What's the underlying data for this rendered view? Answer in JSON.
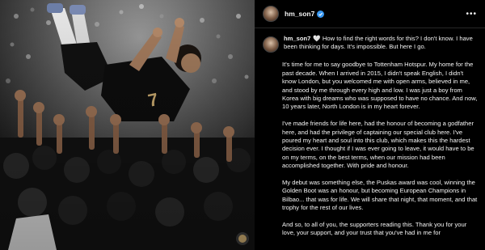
{
  "post": {
    "username": "hm_son7",
    "verified": true,
    "more_icon": "more-dots-icon",
    "avatar_icon": "profile-avatar"
  },
  "caption": {
    "username": "hm_son7",
    "first_line": "🤍 How to find the right words for this? I don't know. I have been thinking for days. It's impossible. But here I go.",
    "paragraphs": [
      "It's time for me to say goodbye to Tottenham Hotspur. My home for the past decade. When I arrived in 2015, I didn't speak English, I didn't know London, but you welcomed me with open arms, believed in me, and stood by me through every high and low. I was just a boy from Korea with big dreams who was supposed to have no chance. And now, 10 years later, North London is in my heart forever.",
      "I've made friends for life here, had the honour of becoming a godfather here, and had the privilege of captaining our special club here. I've poured my heart and soul into this club, which makes this the hardest decision ever. I thought if I was ever going to leave, it would have to be on my terms, on the best terms, when our mission had been accomplished together. With pride and honour.",
      "My debut was something else, the Puskas award was cool, winning the Golden Boot was an honour, but becoming European Champions in Bilbao... that was for life. We will share that night, that moment, and that trophy for the rest of our lives.",
      "And so, to all of you, the supporters reading this. Thank you for your love, your support, and your trust that you've had in me for"
    ]
  },
  "colors": {
    "background": "#000000",
    "text": "#f5f5f5",
    "verified_badge": "#3897f0",
    "divider": "#262626"
  }
}
